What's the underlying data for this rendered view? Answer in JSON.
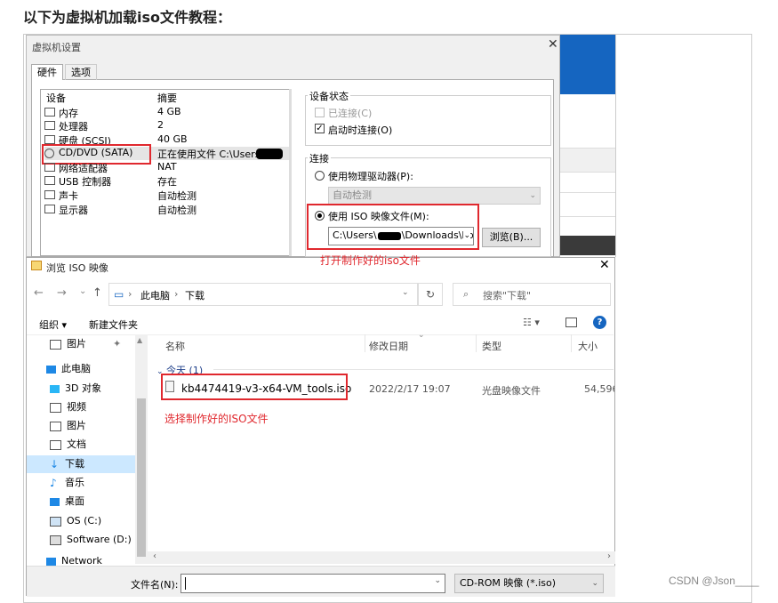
{
  "heading": "以下为虚拟机加载iso文件教程：",
  "footer": "CSDN @Json____",
  "vm_dialog": {
    "title": "虚拟机设置",
    "tabs": [
      "硬件",
      "选项"
    ],
    "columns": {
      "device": "设备",
      "summary": "摘要"
    },
    "devices": [
      {
        "name": "内存",
        "summary": "4 GB",
        "icon": "memory-icon"
      },
      {
        "name": "处理器",
        "summary": "2",
        "icon": "cpu-icon"
      },
      {
        "name": "硬盘 (SCSI)",
        "summary": "40 GB",
        "icon": "disk-icon"
      },
      {
        "name": "CD/DVD (SATA)",
        "summary": "正在使用文件 C:\\Users\\",
        "icon": "cd-icon"
      },
      {
        "name": "网络适配器",
        "summary": "NAT",
        "icon": "network-icon"
      },
      {
        "name": "USB 控制器",
        "summary": "存在",
        "icon": "usb-icon"
      },
      {
        "name": "声卡",
        "summary": "自动检测",
        "icon": "sound-icon"
      },
      {
        "name": "显示器",
        "summary": "自动检测",
        "icon": "display-icon"
      }
    ],
    "device_status": {
      "label": "设备状态",
      "connected": "已连接(C)",
      "connect_on_start": "启动时连接(O)"
    },
    "connection": {
      "label": "连接",
      "physical": "使用物理驱动器(P):",
      "auto": "自动检测",
      "iso": "使用 ISO 映像文件(M):",
      "iso_path": "C:\\Users\\",
      "iso_path_tail": "\\Downloads\\kb",
      "browse": "浏览(B)..."
    },
    "annotation": "打开制作好的iso文件"
  },
  "browse_dialog": {
    "title": "浏览 ISO 映像",
    "breadcrumb": [
      "此电脑",
      "下载"
    ],
    "search_placeholder": "搜索\"下载\"",
    "organize": "组织",
    "new_folder": "新建文件夹",
    "nav": [
      {
        "label": "图片",
        "icon": "pictures-icon"
      },
      {
        "label": "此电脑",
        "icon": "pc-icon"
      },
      {
        "label": "3D 对象",
        "icon": "3d-objects-icon"
      },
      {
        "label": "视频",
        "icon": "video-icon"
      },
      {
        "label": "图片",
        "icon": "pictures-icon"
      },
      {
        "label": "文档",
        "icon": "documents-icon"
      },
      {
        "label": "下载",
        "icon": "download-icon"
      },
      {
        "label": "音乐",
        "icon": "music-icon"
      },
      {
        "label": "桌面",
        "icon": "desktop-icon"
      },
      {
        "label": "OS (C:)",
        "icon": "drive-icon"
      },
      {
        "label": "Software (D:)",
        "icon": "drive-icon"
      },
      {
        "label": "Network",
        "icon": "network-icon"
      }
    ],
    "columns": {
      "name": "名称",
      "modified": "修改日期",
      "type": "类型",
      "size": "大小"
    },
    "group": "今天 (1)",
    "file": {
      "name": "kb4474419-v3-x64-VM_tools.iso",
      "modified": "2022/2/17 19:07",
      "type": "光盘映像文件",
      "size": "54,596"
    },
    "annotation": "选择制作好的ISO文件",
    "filename_label": "文件名(N):",
    "filetype": "CD-ROM 映像 (*.iso)"
  },
  "colors": {
    "annotation_red": "#e0282e",
    "bg_blue": "#1565c0",
    "selected": "#cce8ff"
  }
}
